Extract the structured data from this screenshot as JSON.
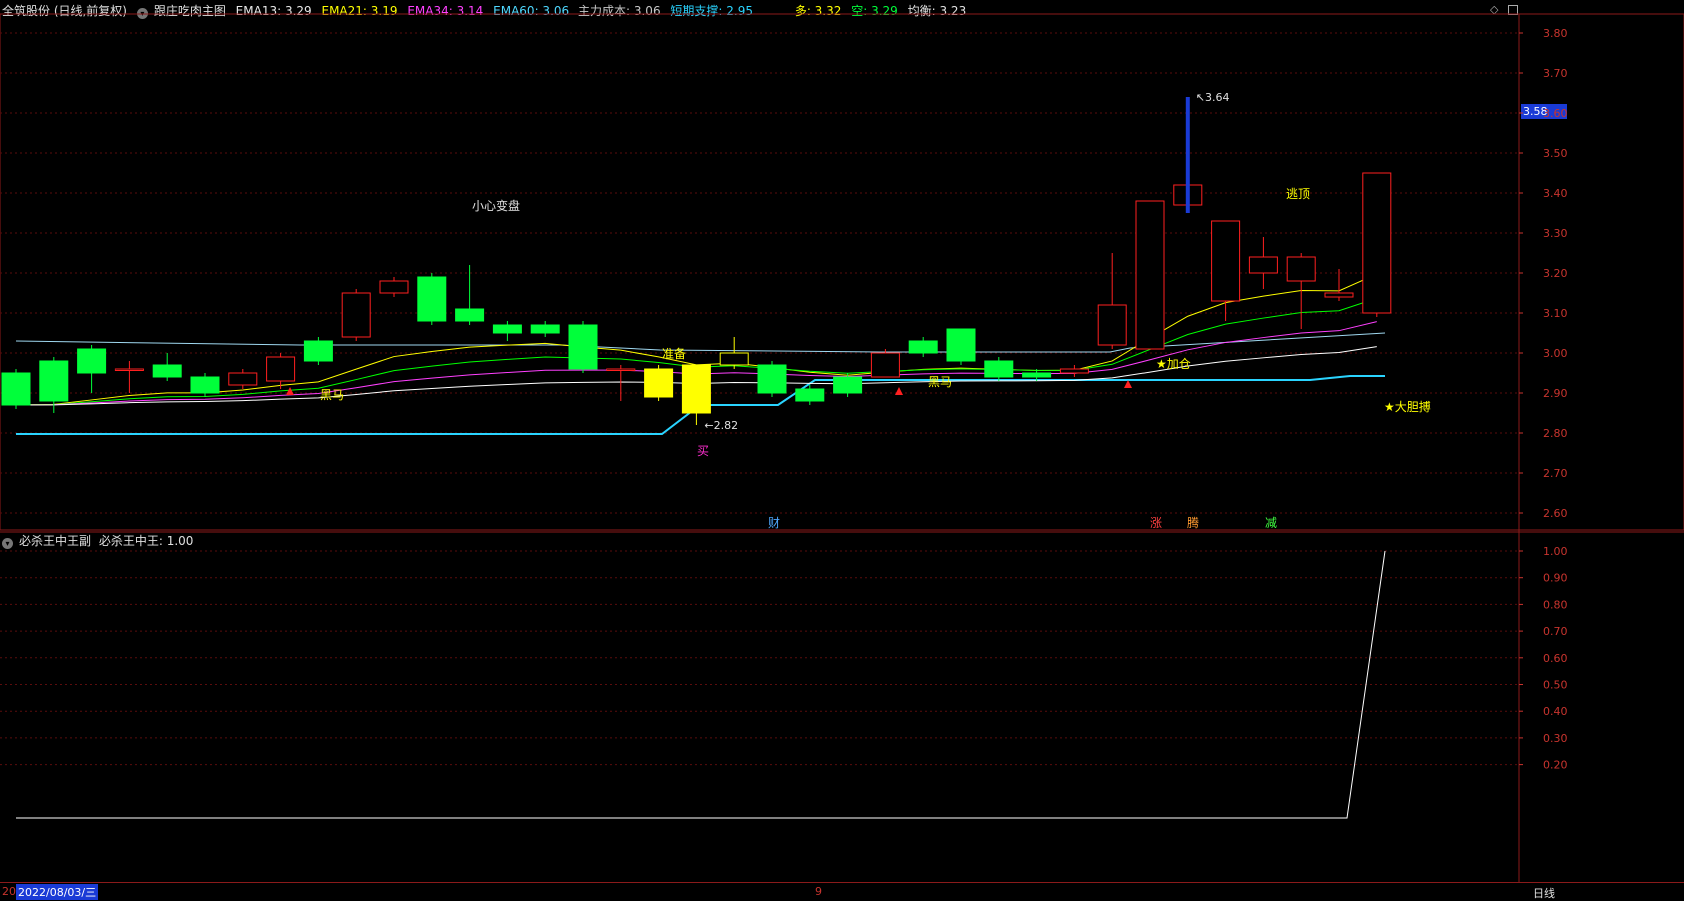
{
  "header": {
    "stock": "全筑股份 (日线,前复权)",
    "indicator_name": "跟庄吃肉主图",
    "ema13_label": "EMA13: 3.29",
    "ema21_label": "EMA21: 3.19",
    "ema34_label": "EMA34: 3.14",
    "ema60_label": "EMA60: 3.06",
    "cost_label": "主力成本: 3.06",
    "support_label": "短期支撑: 2.95",
    "long_label": "多: 3.32",
    "short_label": "空: 3.29",
    "balance_label": "均衡: 3.23",
    "price_tag": "3.58",
    "sub_title": "必杀王中王副",
    "sub_value": "必杀王中王: 1.00",
    "date_prefix": "20",
    "date_label": "2022/08/03/三",
    "date_mark": "9",
    "period_label": "日线"
  },
  "colors": {
    "up": "#ff2020",
    "down": "#00ff3a",
    "ema13": "#ffff00",
    "ema21": "#00ff00",
    "ema34": "#ff40ff",
    "ema60": "#ffffff",
    "support": "#2ad4ff",
    "axis": "#c8342e"
  },
  "chart_data": [
    {
      "type": "candlestick",
      "yticks": [
        "3.80",
        "3.70",
        "3.60",
        "3.50",
        "3.40",
        "3.30",
        "3.20",
        "3.10",
        "3.00",
        "2.90",
        "2.80",
        "2.70",
        "2.60"
      ],
      "ylim": [
        2.57,
        3.84
      ],
      "candles": [
        {
          "o": 2.95,
          "c": 2.87,
          "h": 2.96,
          "l": 2.86
        },
        {
          "o": 2.98,
          "c": 2.88,
          "h": 2.99,
          "l": 2.85
        },
        {
          "o": 3.01,
          "c": 2.95,
          "h": 3.02,
          "l": 2.9
        },
        {
          "o": 2.96,
          "c": 2.96,
          "h": 2.98,
          "l": 2.9
        },
        {
          "o": 2.97,
          "c": 2.94,
          "h": 3.0,
          "l": 2.93
        },
        {
          "o": 2.94,
          "c": 2.9,
          "h": 2.95,
          "l": 2.89
        },
        {
          "o": 2.92,
          "c": 2.95,
          "h": 2.96,
          "l": 2.91
        },
        {
          "o": 2.93,
          "c": 2.99,
          "h": 3.0,
          "l": 2.91
        },
        {
          "o": 3.03,
          "c": 2.98,
          "h": 3.04,
          "l": 2.97
        },
        {
          "o": 3.04,
          "c": 3.15,
          "h": 3.16,
          "l": 3.03
        },
        {
          "o": 3.15,
          "c": 3.18,
          "h": 3.19,
          "l": 3.14
        },
        {
          "o": 3.19,
          "c": 3.08,
          "h": 3.2,
          "l": 3.07
        },
        {
          "o": 3.11,
          "c": 3.08,
          "h": 3.22,
          "l": 3.07
        },
        {
          "o": 3.07,
          "c": 3.05,
          "h": 3.08,
          "l": 3.03
        },
        {
          "o": 3.07,
          "c": 3.05,
          "h": 3.08,
          "l": 3.04
        },
        {
          "o": 3.07,
          "c": 2.96,
          "h": 3.08,
          "l": 2.95
        },
        {
          "o": 2.96,
          "c": 2.96,
          "h": 2.97,
          "l": 2.88
        },
        {
          "o": 2.96,
          "c": 2.89,
          "h": 2.97,
          "l": 2.88
        },
        {
          "o": 2.97,
          "c": 2.85,
          "h": 2.97,
          "l": 2.82
        },
        {
          "o": 2.97,
          "c": 3.0,
          "h": 3.04,
          "l": 2.96
        },
        {
          "o": 2.97,
          "c": 2.9,
          "h": 2.98,
          "l": 2.89
        },
        {
          "o": 2.91,
          "c": 2.88,
          "h": 2.92,
          "l": 2.87
        },
        {
          "o": 2.94,
          "c": 2.9,
          "h": 2.95,
          "l": 2.89
        },
        {
          "o": 2.94,
          "c": 3.0,
          "h": 3.01,
          "l": 2.94
        },
        {
          "o": 3.03,
          "c": 3.0,
          "h": 3.04,
          "l": 2.99
        },
        {
          "o": 3.06,
          "c": 2.98,
          "h": 3.06,
          "l": 2.97
        },
        {
          "o": 2.98,
          "c": 2.94,
          "h": 2.99,
          "l": 2.93
        },
        {
          "o": 2.95,
          "c": 2.94,
          "h": 2.96,
          "l": 2.93
        },
        {
          "o": 2.95,
          "c": 2.96,
          "h": 2.97,
          "l": 2.94
        },
        {
          "o": 3.02,
          "c": 3.12,
          "h": 3.25,
          "l": 3.01
        },
        {
          "o": 3.01,
          "c": 3.38,
          "h": 3.38,
          "l": 3.01
        },
        {
          "o": 3.37,
          "c": 3.42,
          "h": 3.64,
          "l": 3.35
        },
        {
          "o": 3.13,
          "c": 3.33,
          "h": 3.33,
          "l": 3.08
        },
        {
          "o": 3.2,
          "c": 3.24,
          "h": 3.29,
          "l": 3.16
        },
        {
          "o": 3.18,
          "c": 3.24,
          "h": 3.25,
          "l": 3.06
        },
        {
          "o": 3.14,
          "c": 3.15,
          "h": 3.21,
          "l": 3.13
        },
        {
          "o": 3.1,
          "c": 3.45,
          "h": 3.45,
          "l": 3.09
        }
      ],
      "price_labels": [
        "3.64",
        "2.82"
      ],
      "annotations": [
        "小心变盘",
        "黑马",
        "准备",
        "买",
        "黑马",
        "★加仓",
        "逃顶",
        "★大胆搏"
      ],
      "bottom_marks": [
        "财",
        "涨",
        "腾",
        "减"
      ]
    },
    {
      "type": "line",
      "title": "必杀王中王副",
      "yticks": [
        "1.00",
        "0.90",
        "0.80",
        "0.70",
        "0.60",
        "0.50",
        "0.40",
        "0.30",
        "0.20"
      ],
      "ylim": [
        0.0,
        1.0
      ],
      "values": [
        0,
        0,
        0,
        0,
        0,
        0,
        0,
        0,
        0,
        0,
        0,
        0,
        0,
        0,
        0,
        0,
        0,
        0,
        0,
        0,
        0,
        0,
        0,
        0,
        0,
        0,
        0,
        0,
        0,
        0,
        0,
        0,
        0,
        0,
        0,
        0,
        1.0
      ]
    }
  ]
}
